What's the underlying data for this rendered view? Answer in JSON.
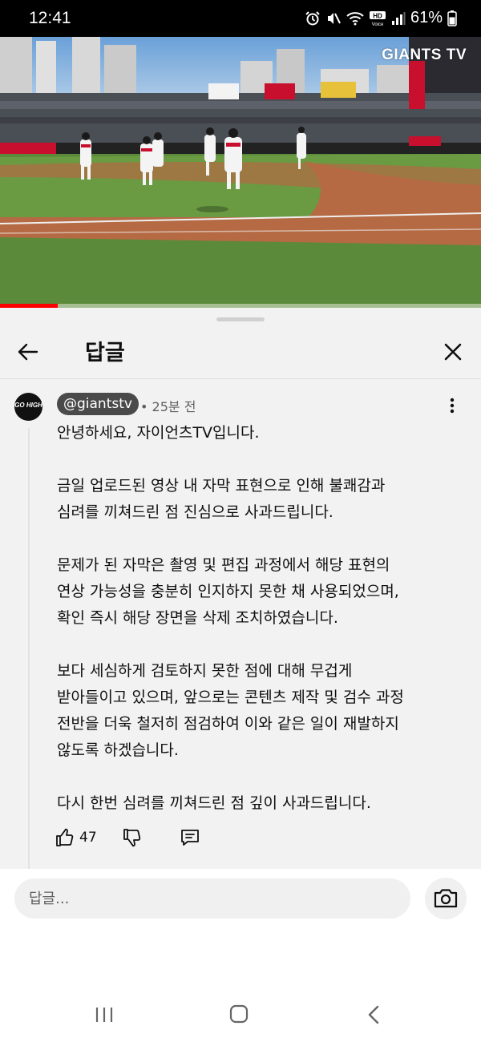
{
  "status_bar": {
    "time": "12:41",
    "battery_percent": "61%",
    "icons": [
      "alarm-icon",
      "mute-icon",
      "wifi-icon",
      "hd-voice-icon",
      "signal-icon",
      "battery-icon"
    ]
  },
  "video": {
    "watermark": "GIANTS TV",
    "progress": 0.12,
    "accent_color": "#ff0000"
  },
  "sheet": {
    "title": "답글"
  },
  "comment": {
    "author": "@giantstv",
    "time": "• 25분 전",
    "avatar_text": "GO HIGH",
    "lines": [
      "안녕하세요, 자이언츠TV입니다.",
      "금일 업로드된 영상 내 자막 표현으로 인해 불쾌감과",
      "심려를 끼쳐드린 점 진심으로 사과드립니다.",
      "문제가 된 자막은 촬영 및 편집 과정에서 해당 표현의",
      "연상 가능성을 충분히 인지하지 못한 채 사용되었으며,",
      "확인 즉시 해당 장면을 삭제 조치하였습니다.",
      "보다 세심하게 검토하지 못한 점에 대해 무겁게",
      "받아들이고 있으며, 앞으로는 콘텐츠 제작 및 검수 과정",
      "전반을 더욱 철저히 점검하여 이와 같은 일이 재발하지",
      "않도록 하겠습니다.",
      "다시 한번 심려를 끼쳐드린 점 깊이 사과드립니다."
    ],
    "like_count": "47"
  },
  "reply_bar": {
    "placeholder": "답글..."
  }
}
